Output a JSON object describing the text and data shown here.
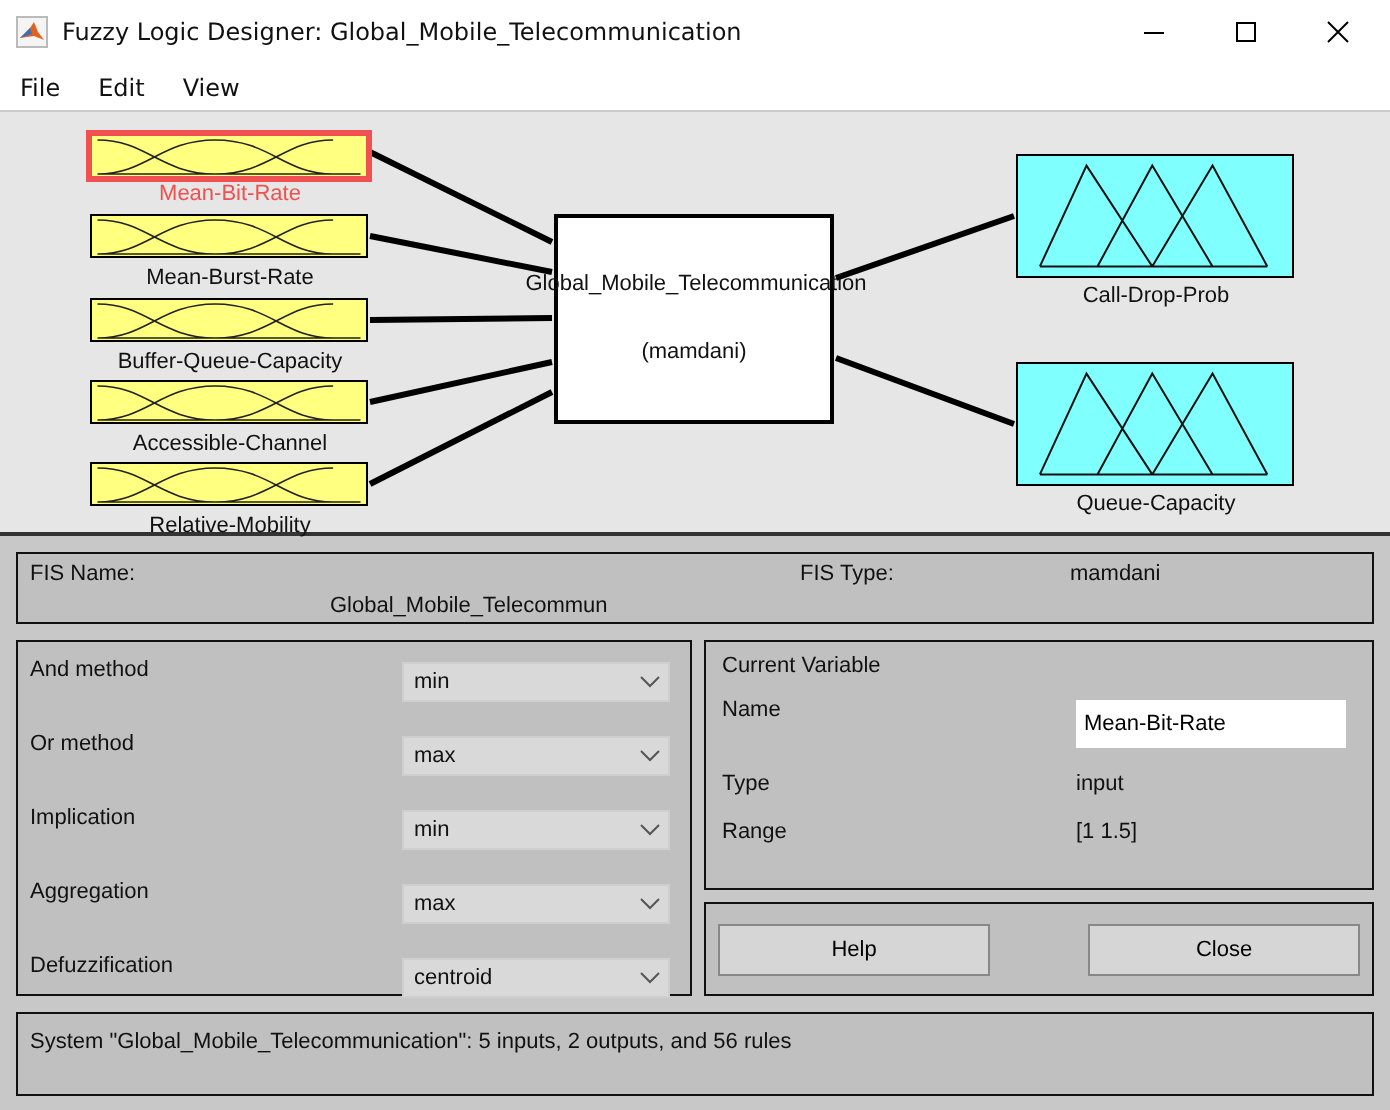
{
  "window": {
    "title": "Fuzzy Logic Designer: Global_Mobile_Telecommunication"
  },
  "menu": [
    "File",
    "Edit",
    "View"
  ],
  "diagram": {
    "inputs": [
      {
        "label": "Mean-Bit-Rate",
        "selected": true
      },
      {
        "label": "Mean-Burst-Rate",
        "selected": false
      },
      {
        "label": "Buffer-Queue-Capacity",
        "selected": false
      },
      {
        "label": "Accessible-Channel",
        "selected": false
      },
      {
        "label": "Relative-Mobility",
        "selected": false
      }
    ],
    "system": {
      "name": "Global_Mobile_Telecommunication",
      "type": "(mamdani)"
    },
    "outputs": [
      {
        "label": "Call-Drop-Prob",
        "selected": false
      },
      {
        "label": "Queue-Capacity",
        "selected": false
      }
    ]
  },
  "fis": {
    "name_label": "FIS Name:",
    "name_value": "Global_Mobile_Telecommun",
    "type_label": "FIS Type:",
    "type_value": "mamdani"
  },
  "methods": [
    {
      "label": "And method",
      "value": "min"
    },
    {
      "label": "Or method",
      "value": "max"
    },
    {
      "label": "Implication",
      "value": "min"
    },
    {
      "label": "Aggregation",
      "value": "max"
    },
    {
      "label": "Defuzzification",
      "value": "centroid"
    }
  ],
  "current_variable": {
    "title": "Current Variable",
    "name_label": "Name",
    "name_value": "Mean-Bit-Rate",
    "type_label": "Type",
    "type_value": "input",
    "range_label": "Range",
    "range_value": "[1 1.5]"
  },
  "buttons": [
    "Help",
    "Close"
  ],
  "status_bar": "System \"Global_Mobile_Telecommunication\": 5 inputs, 2 outputs, and 56 rules"
}
